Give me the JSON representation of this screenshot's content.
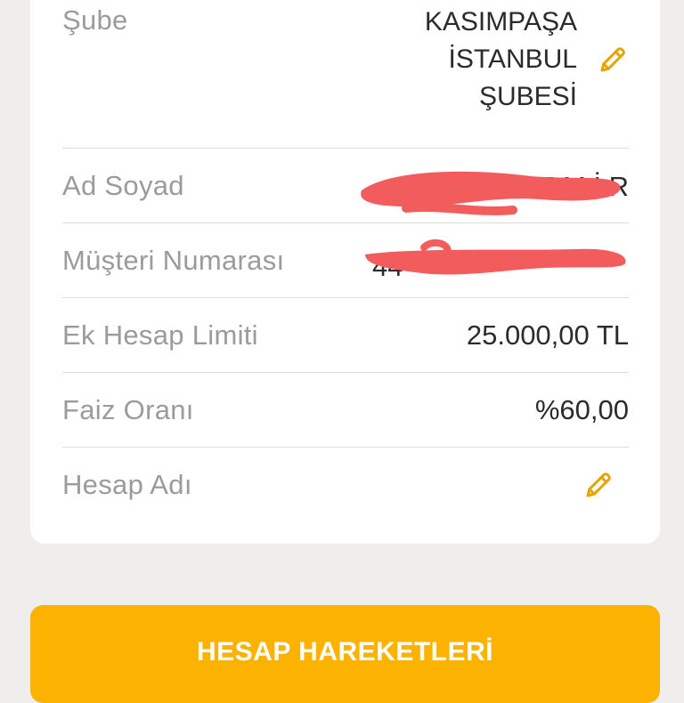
{
  "account_details": {
    "branch": {
      "label": "Şube",
      "value_line1": "KASIMPAŞA",
      "value_line2": "İSTANBUL",
      "value_line3": "ŞUBESİ",
      "edit_icon": "pencil-icon"
    },
    "name": {
      "label": "Ad Soyad",
      "value_visible_fragment": "E M İ R",
      "redacted": true
    },
    "customer_number": {
      "label": "Müşteri Numarası",
      "value_visible_fragment": "44",
      "redacted": true
    },
    "overdraft_limit": {
      "label": "Ek Hesap Limiti",
      "value": "25.000,00 TL"
    },
    "interest_rate": {
      "label": "Faiz Oranı",
      "value": "%60,00"
    },
    "account_name": {
      "label": "Hesap Adı",
      "edit_icon": "pencil-icon"
    }
  },
  "actions": {
    "transactions_button": "HESAP HAREKETLERİ"
  },
  "colors": {
    "accent": "#fbb200",
    "edit_icon": "#e6a400",
    "redaction": "#f25c5c",
    "background": "#efeeec"
  }
}
